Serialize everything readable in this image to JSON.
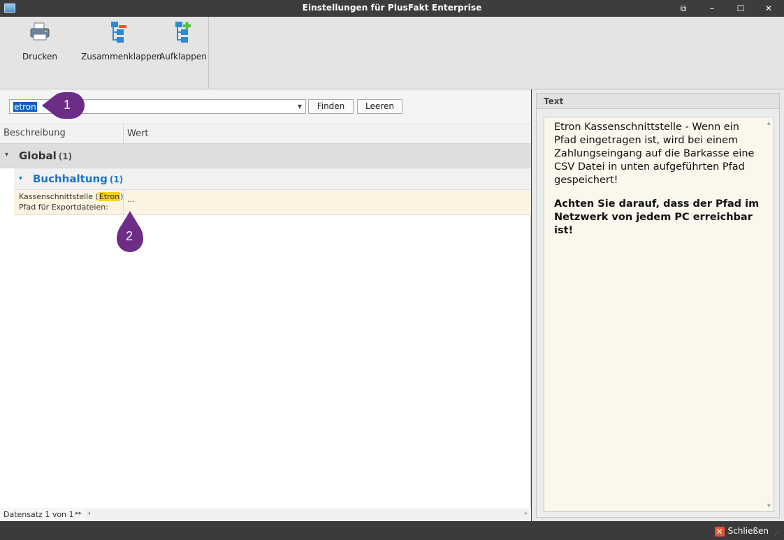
{
  "window": {
    "title": "Einstellungen für PlusFakt Enterprise",
    "controls": {
      "restore": "⧉",
      "minimize": "–",
      "maximize": "☐",
      "close": "✕"
    }
  },
  "ribbon": {
    "print_label": "Drucken",
    "collapse_label": "Zusammenklappen",
    "expand_label": "Aufklappen"
  },
  "search": {
    "value": "etron",
    "find_label": "Finden",
    "clear_label": "Leeren"
  },
  "grid": {
    "col_description": "Beschreibung",
    "col_value": "Wert",
    "group_level1": {
      "name": "Global",
      "count": "(1)"
    },
    "group_level2": {
      "name": "Buchhaltung",
      "count": "(1)"
    },
    "row": {
      "desc_prefix": "Kassenschnittstelle (",
      "desc_highlight": "Etron",
      "desc_suffix": ")",
      "desc_line2": "Pfad für Exportdateien:",
      "value": "..."
    },
    "record_text": "Datensatz 1 von 1"
  },
  "text_panel": {
    "header": "Text",
    "paragraph": "Etron Kassenschnittstelle - Wenn ein Pfad eingetragen ist, wird bei einem Zahlungseingang auf die Barkasse eine CSV Datei in unten aufgeführten Pfad gespeichert!",
    "bold_note": "Achten Sie darauf, dass der Pfad im Netzwerk von jedem PC erreichbar ist!"
  },
  "status": {
    "close_label": "Schließen"
  },
  "markers": {
    "one": "1",
    "two": "2"
  },
  "colors": {
    "accent_blue": "#1e73c8",
    "highlight_yellow": "#f7d21c",
    "marker_purple": "#6b2d86",
    "close_red": "#e4542e"
  }
}
